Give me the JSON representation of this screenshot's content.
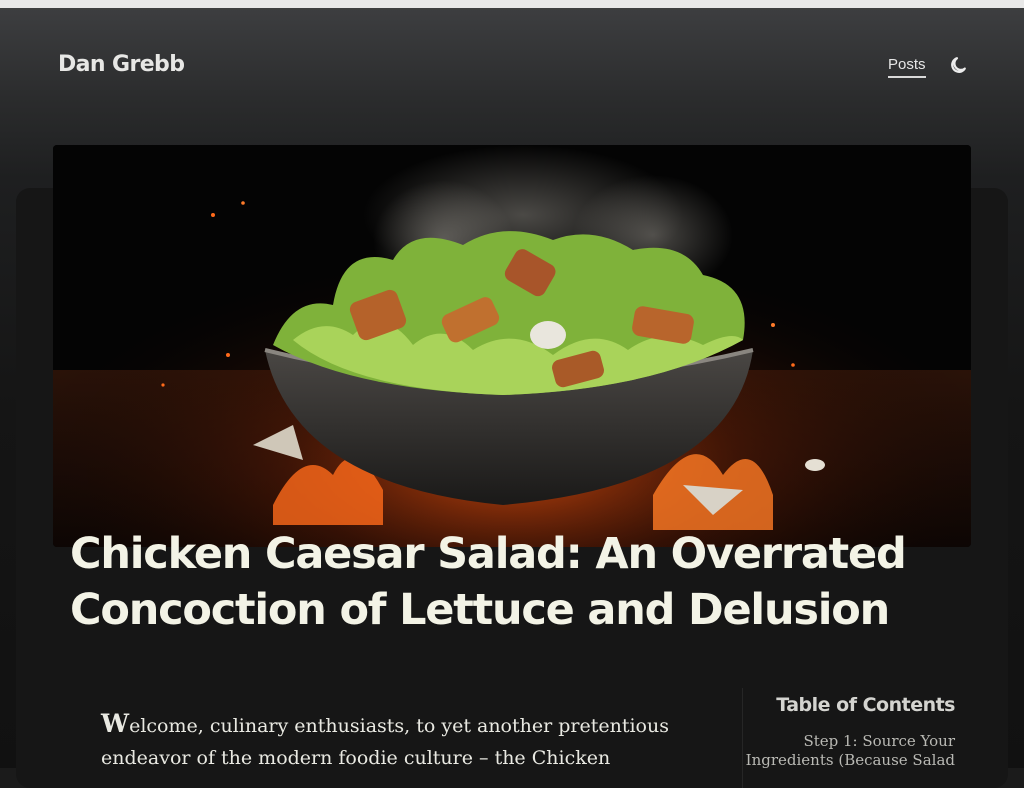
{
  "site": {
    "title": "Dan Grebb"
  },
  "nav": {
    "posts_label": "Posts",
    "theme_toggle_icon": "moon-icon"
  },
  "hero": {
    "image": "chicken-caesar-salad-bowl-over-fire"
  },
  "post": {
    "title": "Chicken Caesar Salad: An Overrated Concoction of Lettuce and Delusion",
    "intro_dropcap": "W",
    "intro_text": "elcome, culinary enthusiasts, to yet another pretentious endeavor of the modern foodie culture – the Chicken"
  },
  "toc": {
    "title": "Table of Contents",
    "items": [
      "Step 1: Source Your Ingredients (Because Salad"
    ]
  },
  "colors": {
    "background": "#1b1b1b",
    "title_text": "#f3f3e6",
    "body_text": "#e9e9e2",
    "accent_fire": "#ff6a1a"
  }
}
